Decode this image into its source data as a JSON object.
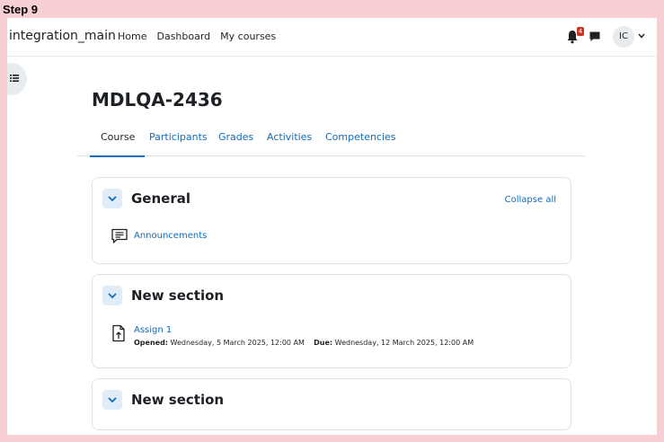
{
  "step_label": "Step 9",
  "navbar": {
    "brand": "integration_main",
    "links": [
      "Home",
      "Dashboard",
      "My courses"
    ],
    "notification_count": "4",
    "avatar_initials": "IC"
  },
  "course": {
    "title": "MDLQA-2436",
    "tabs": [
      "Course",
      "Participants",
      "Grades",
      "Activities",
      "Competencies"
    ]
  },
  "sections": [
    {
      "title": "General",
      "collapse_all": "Collapse all",
      "activities": [
        {
          "name": "Announcements",
          "icon": "forum-icon"
        }
      ]
    },
    {
      "title": "New section",
      "activities": [
        {
          "name": "Assign 1",
          "icon": "assignment-icon",
          "opened_label": "Opened:",
          "opened_value": "Wednesday, 5 March 2025, 12:00 AM",
          "due_label": "Due:",
          "due_value": "Wednesday, 12 March 2025, 12:00 AM"
        }
      ]
    },
    {
      "title": "New section",
      "activities": []
    }
  ],
  "colors": {
    "link": "#0f6cbf",
    "badge": "#ca3120",
    "background": "#f8d0d4"
  }
}
